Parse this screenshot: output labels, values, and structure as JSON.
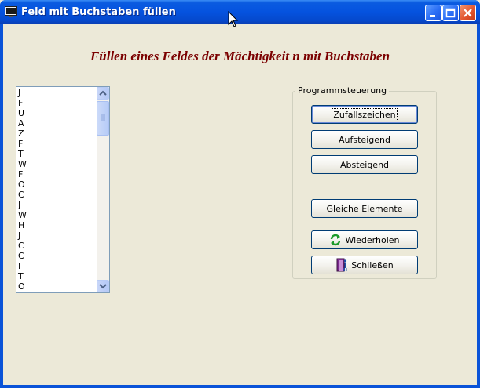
{
  "window": {
    "title": "Feld mit Buchstaben füllen",
    "icon": "app-window-icon",
    "controls": [
      "minimize-icon",
      "maximize-icon",
      "close-icon"
    ]
  },
  "heading": "Füllen eines Feldes der Mächtigkeit n mit Buchstaben",
  "listbox": {
    "items": [
      "J",
      "F",
      "U",
      "A",
      "Z",
      "F",
      "T",
      "W",
      "F",
      "O",
      "C",
      "J",
      "W",
      "H",
      "J",
      "C",
      "C",
      "I",
      "T",
      "O"
    ]
  },
  "group": {
    "label": "Programmsteuerung",
    "buttons": {
      "random": "Zufallszeichen",
      "ascending": "Aufsteigend",
      "descending": "Absteigend",
      "equal": "Gleiche Elemente",
      "repeat": "Wiederholen",
      "close": "Schließen"
    }
  },
  "colors": {
    "heading": "#7b0000",
    "face": "#ece9d8",
    "titlebar": "#0553df"
  }
}
